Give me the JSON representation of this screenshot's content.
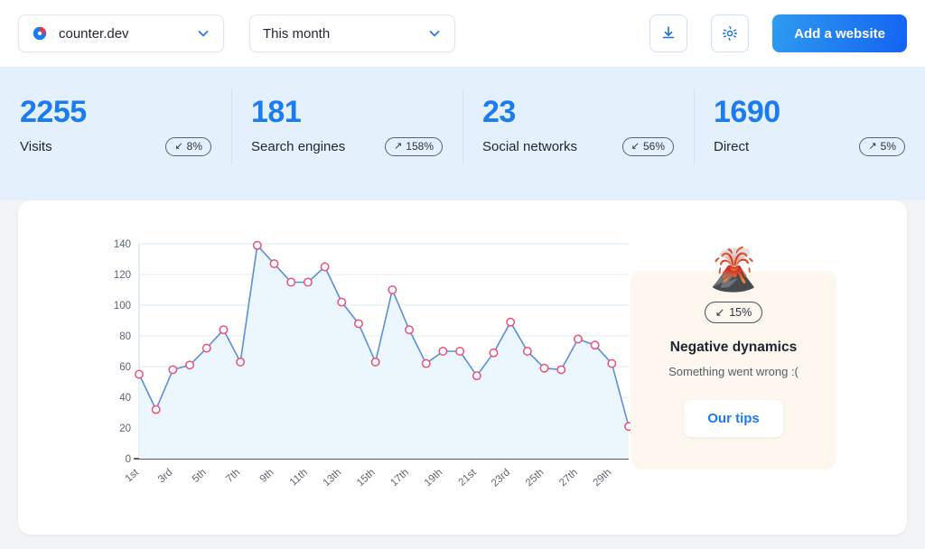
{
  "header": {
    "site_select": {
      "label": "counter.dev",
      "icon": "pie-logo-icon",
      "chevron": "chevron-down-icon"
    },
    "period_select": {
      "label": "This month",
      "chevron": "chevron-down-icon"
    },
    "download_button": {
      "icon": "download-icon"
    },
    "settings_button": {
      "icon": "gear-icon"
    },
    "add_website_button": {
      "label": "Add a website"
    }
  },
  "stats": [
    {
      "value": "2255",
      "name": "Visits",
      "badge": {
        "arrow": "↙",
        "text": "8%",
        "direction": "down"
      }
    },
    {
      "value": "181",
      "name": "Search engines",
      "badge": {
        "arrow": "↗",
        "text": "158%",
        "direction": "up"
      }
    },
    {
      "value": "23",
      "name": "Social networks",
      "badge": {
        "arrow": "↙",
        "text": "56%",
        "direction": "down"
      }
    },
    {
      "value": "1690",
      "name": "Direct",
      "badge": {
        "arrow": "↗",
        "text": "5%",
        "direction": "up"
      }
    }
  ],
  "side_panel": {
    "emoji": "🌋",
    "badge": {
      "arrow": "↙",
      "text": "15%"
    },
    "title": "Negative dynamics",
    "subtitle": "Something went wrong :(",
    "button_label": "Our tips"
  },
  "colors": {
    "accent_blue": "#1a7cf0",
    "stats_band": "#e4f0fc",
    "marker_pink": "#e8517a",
    "line_blue": "#5b8fd6",
    "grid": "#d9ecf8",
    "panel_cream": "#fdf7ef"
  },
  "chart_data": {
    "type": "line",
    "title": "",
    "xlabel": "",
    "ylabel": "",
    "grid": true,
    "legend": "none",
    "ylim": [
      0,
      140
    ],
    "yticks": [
      0,
      20,
      40,
      60,
      80,
      100,
      120,
      140
    ],
    "x": [
      "1st",
      "2nd",
      "3rd",
      "4th",
      "5th",
      "6th",
      "7th",
      "8th",
      "9th",
      "10th",
      "11th",
      "12th",
      "13th",
      "14th",
      "15th",
      "16th",
      "17th",
      "18th",
      "19th",
      "20th",
      "21st",
      "22nd",
      "23rd",
      "24th",
      "25th",
      "26th",
      "27th",
      "28th",
      "29th",
      "30th"
    ],
    "xtick_labels": [
      "1st",
      "3rd",
      "5th",
      "7th",
      "9th",
      "11th",
      "13th",
      "15th",
      "17th",
      "19th",
      "21st",
      "23rd",
      "25th",
      "27th",
      "29th"
    ],
    "values": [
      55,
      32,
      58,
      61,
      72,
      84,
      63,
      139,
      127,
      115,
      115,
      125,
      102,
      88,
      63,
      110,
      84,
      62,
      70,
      70,
      54,
      69,
      89,
      70,
      59,
      58,
      78,
      74,
      62,
      21
    ],
    "series": [
      {
        "name": "Visits",
        "values": [
          55,
          32,
          58,
          61,
          72,
          84,
          63,
          139,
          127,
          115,
          115,
          125,
          102,
          88,
          63,
          110,
          84,
          62,
          70,
          70,
          54,
          69,
          89,
          70,
          59,
          58,
          78,
          74,
          62,
          21
        ]
      }
    ]
  }
}
